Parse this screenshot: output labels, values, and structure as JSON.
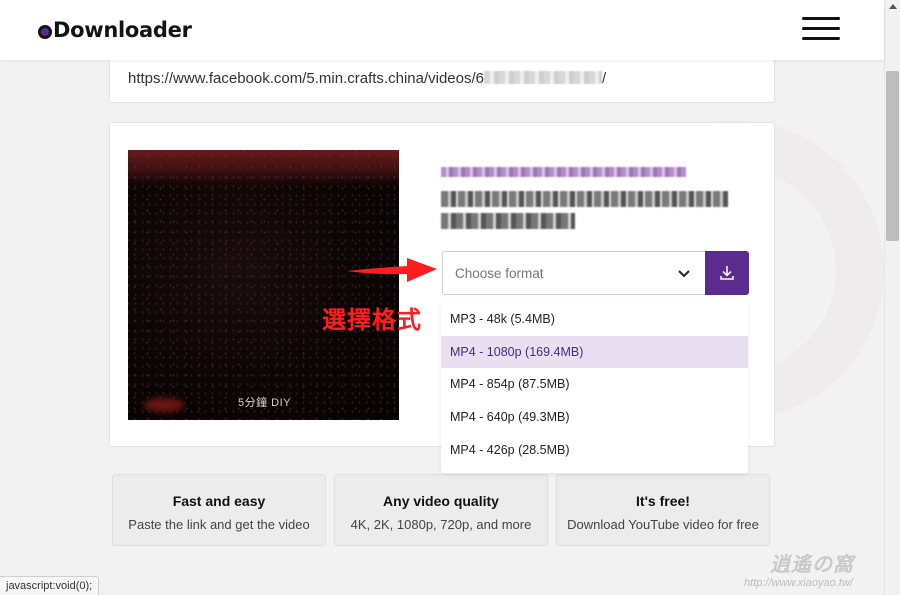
{
  "header": {
    "logo_text": "Downloader",
    "menu_icon": "hamburger-menu-icon"
  },
  "url_input": {
    "value": "https://www.facebook.com/5.min.crafts.china/videos/6",
    "value_tail": "/"
  },
  "result": {
    "thumbnail_watermark": "5分鐘 DIY",
    "format_select": {
      "placeholder": "Choose format"
    },
    "download_icon": "download-icon",
    "formats": [
      {
        "label": "MP3 - 48k (5.4MB)"
      },
      {
        "label": "MP4 - 1080p (169.4MB)"
      },
      {
        "label": "MP4 - 854p (87.5MB)"
      },
      {
        "label": "MP4 - 640p (49.3MB)"
      },
      {
        "label": "MP4 - 426p (28.5MB)"
      }
    ],
    "selected_index": 1
  },
  "annotation": {
    "text": "選擇格式",
    "color": "#ff1d1d"
  },
  "features": [
    {
      "title": "Fast and easy",
      "desc": "Paste the link and get the video"
    },
    {
      "title": "Any video quality",
      "desc": "4K, 2K, 1080p, 720p, and more"
    },
    {
      "title": "It's free!",
      "desc": "Download YouTube video for free"
    }
  ],
  "status_bar": {
    "text": "javascript:void(0);"
  },
  "watermark": {
    "title": "逍遙の窩",
    "url": "http://www.xiaoyao.tw/"
  },
  "colors": {
    "accent": "#5b2c8e",
    "selected_bg": "#e8dff0"
  }
}
